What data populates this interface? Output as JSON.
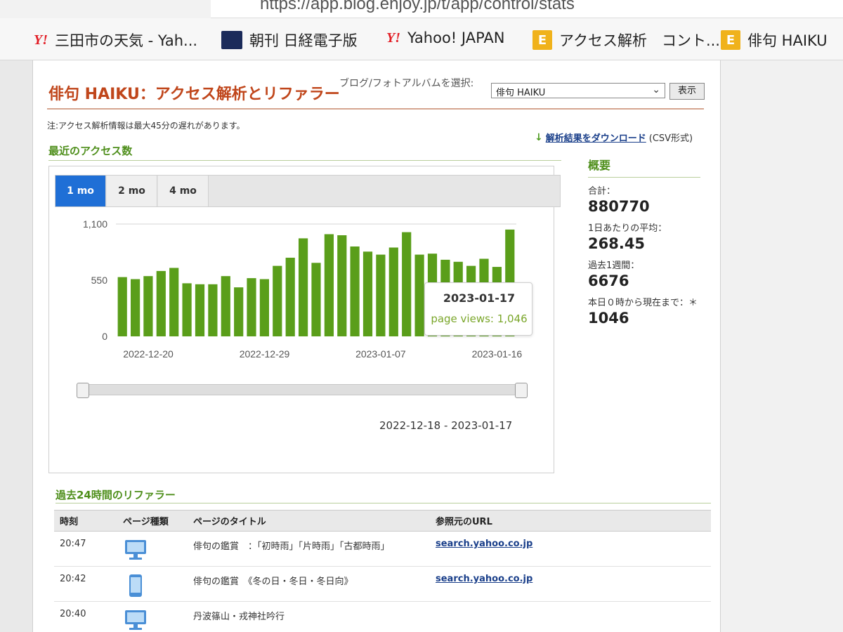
{
  "browser": {
    "url": "https://app.blog.enjoy.jp/t/app/control/stats",
    "bookmarks": [
      {
        "icon": "yahoo-icon",
        "label": "三田市の天気 - Yah..."
      },
      {
        "icon": "nikkei-icon",
        "label": "朝刊 日経電子版"
      },
      {
        "icon": "yahoo-icon",
        "label": "Yahoo! JAPAN"
      },
      {
        "icon": "e-icon",
        "label": "アクセス解析　コント..."
      },
      {
        "icon": "e-icon",
        "label": "俳句 HAIKU"
      }
    ]
  },
  "header": {
    "title": "俳句 HAIKU：アクセス解析とリファラー",
    "select_label": "ブログ/フォトアルバムを選択:",
    "select_value": "俳句 HAIKU",
    "show_button": "表示"
  },
  "note": "注:アクセス解析情報は最大45分の遅れがあります。",
  "download": {
    "link": "解析結果をダウンロード",
    "suffix": "(CSV形式)"
  },
  "recent": {
    "title": "最近のアクセス数",
    "tabs": [
      {
        "label": "1 mo",
        "active": true
      },
      {
        "label": "2 mo",
        "active": false
      },
      {
        "label": "4 mo",
        "active": false
      }
    ],
    "range_text": "2022-12-18 - 2023-01-17",
    "tooltip": {
      "date": "2023-01-17",
      "value": "page views: 1,046"
    }
  },
  "summary": {
    "title": "概要",
    "items": [
      {
        "label": "合計：",
        "value": "880770"
      },
      {
        "label": "1日あたりの平均：",
        "value": "268.45"
      },
      {
        "label": "過去1週間：",
        "value": "6676"
      },
      {
        "label": "本日０時から現在まで：＊",
        "value": "1046"
      }
    ]
  },
  "referrers": {
    "title": "過去24時間のリファラー",
    "columns": [
      "時刻",
      "ページ種類",
      "ページのタイトル",
      "参照元のURL"
    ],
    "rows": [
      {
        "time": "20:47",
        "device": "desktop",
        "title": "俳句の鑑賞　：「初時雨」「片時雨」「古都時雨」",
        "url": "search.yahoo.co.jp"
      },
      {
        "time": "20:42",
        "device": "mobile",
        "title": "俳句の鑑賞　《冬の日・冬日・冬日向》",
        "url": "search.yahoo.co.jp"
      },
      {
        "time": "20:40",
        "device": "desktop",
        "title": "丹波篠山・戎神社吟行",
        "url": ""
      }
    ]
  },
  "chart_data": {
    "type": "bar",
    "title": "",
    "xlabel": "",
    "ylabel": "",
    "ylim": [
      0,
      1100
    ],
    "yticks": [
      "0",
      "550",
      "1,100"
    ],
    "xticks": [
      "2022-12-20",
      "2022-12-29",
      "2023-01-07",
      "2023-01-16"
    ],
    "color": "#5a9e1a",
    "categories": [
      "2022-12-18",
      "2022-12-19",
      "2022-12-20",
      "2022-12-21",
      "2022-12-22",
      "2022-12-23",
      "2022-12-24",
      "2022-12-25",
      "2022-12-26",
      "2022-12-27",
      "2022-12-28",
      "2022-12-29",
      "2022-12-30",
      "2022-12-31",
      "2023-01-01",
      "2023-01-02",
      "2023-01-03",
      "2023-01-04",
      "2023-01-05",
      "2023-01-06",
      "2023-01-07",
      "2023-01-08",
      "2023-01-09",
      "2023-01-10",
      "2023-01-11",
      "2023-01-12",
      "2023-01-13",
      "2023-01-14",
      "2023-01-15",
      "2023-01-16",
      "2023-01-17"
    ],
    "values": [
      580,
      560,
      590,
      640,
      670,
      520,
      510,
      510,
      590,
      480,
      570,
      560,
      690,
      770,
      960,
      720,
      1000,
      990,
      880,
      830,
      800,
      870,
      1020,
      800,
      810,
      750,
      730,
      690,
      760,
      680,
      1046
    ]
  }
}
